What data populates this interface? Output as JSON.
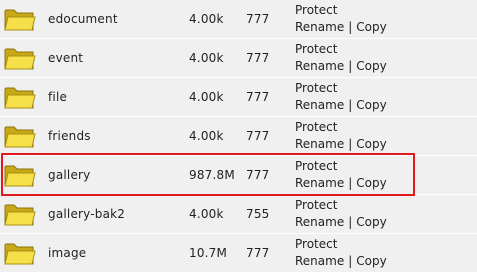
{
  "files": [
    {
      "name": "edocument",
      "size": "4.00k",
      "perm": "777",
      "action_protect": "Protect",
      "action_rename": "Rename",
      "action_sep": "|",
      "action_copy": "Copy"
    },
    {
      "name": "event",
      "size": "4.00k",
      "perm": "777",
      "action_protect": "Protect",
      "action_rename": "Rename",
      "action_sep": "|",
      "action_copy": "Copy"
    },
    {
      "name": "file",
      "size": "4.00k",
      "perm": "777",
      "action_protect": "Protect",
      "action_rename": "Rename",
      "action_sep": "|",
      "action_copy": "Copy"
    },
    {
      "name": "friends",
      "size": "4.00k",
      "perm": "777",
      "action_protect": "Protect",
      "action_rename": "Rename",
      "action_sep": "|",
      "action_copy": "Copy"
    },
    {
      "name": "gallery",
      "size": "987.8M",
      "perm": "777",
      "action_protect": "Protect",
      "action_rename": "Rename",
      "action_sep": "|",
      "action_copy": "Copy"
    },
    {
      "name": "gallery-bak2",
      "size": "4.00k",
      "perm": "755",
      "action_protect": "Protect",
      "action_rename": "Rename",
      "action_sep": "|",
      "action_copy": "Copy"
    },
    {
      "name": "image",
      "size": "10.7M",
      "perm": "777",
      "action_protect": "Protect",
      "action_rename": "Rename",
      "action_sep": "|",
      "action_copy": "Copy"
    }
  ],
  "highlighted_row": "gallery",
  "colors": {
    "row_bg": "#f0f0f0",
    "highlight": "#e3191d",
    "folder": "#f6e04a"
  },
  "icon": "folder-icon"
}
